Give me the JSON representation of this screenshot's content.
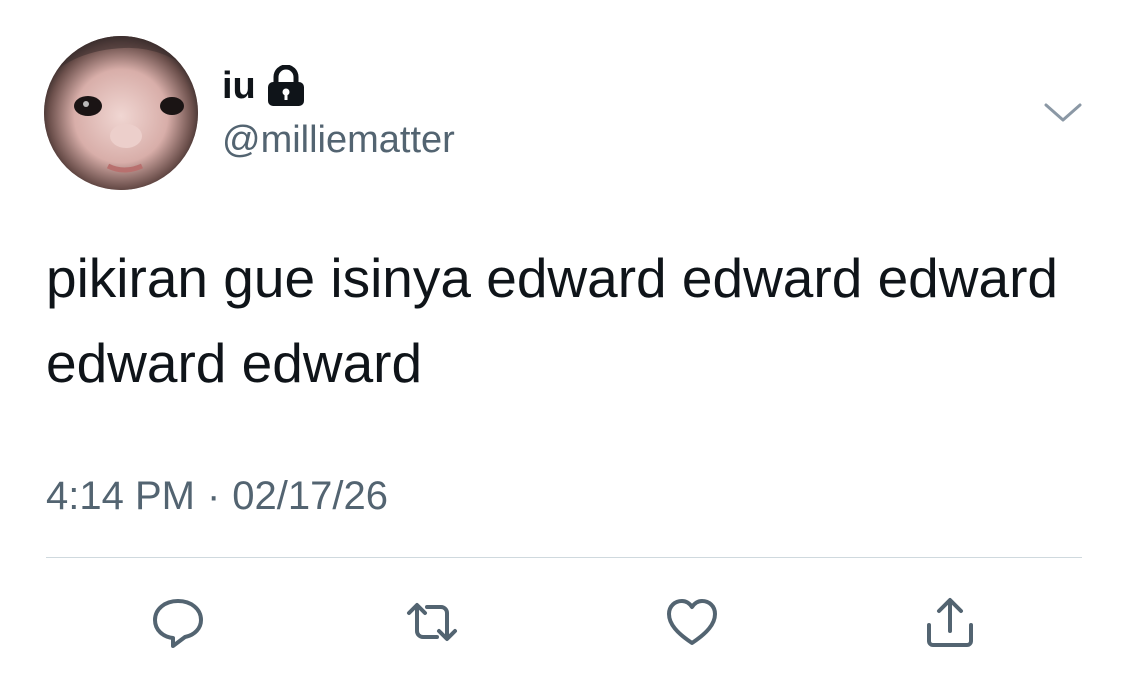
{
  "tweet": {
    "author": {
      "display_name": "iu",
      "handle": "@milliematter",
      "protected_icon": "lock-icon",
      "avatar": "avatar-photo"
    },
    "text": "pikiran gue isinya edward edward edward edward edward",
    "time": "4:14 PM",
    "separator": "·",
    "date": "02/17/26",
    "menu_icon": "chevron-down-icon"
  },
  "actions": [
    {
      "name": "reply",
      "icon": "reply-icon"
    },
    {
      "name": "retweet",
      "icon": "retweet-icon"
    },
    {
      "name": "like",
      "icon": "heart-icon"
    },
    {
      "name": "share",
      "icon": "share-icon"
    }
  ],
  "colors": {
    "text_primary": "#0f1419",
    "text_secondary": "#536471",
    "divider": "#cfd9de",
    "icon": "#536471"
  }
}
